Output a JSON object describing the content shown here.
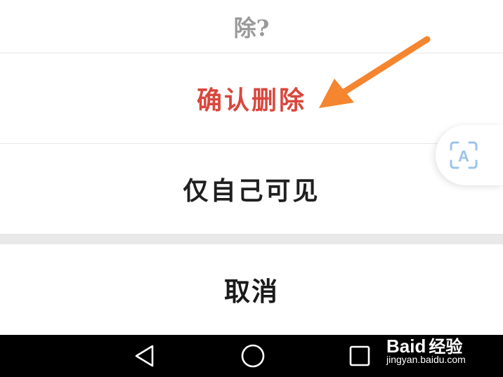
{
  "dialog": {
    "prompt_tail": "除?"
  },
  "action_sheet": {
    "confirm_delete": "确认删除",
    "visible_to_self": "仅自己可见",
    "cancel": "取消"
  },
  "floating_button": {
    "icon": "text-recognition-icon",
    "glyph": "A"
  },
  "nav_bar": {
    "back_icon": "back-triangle-icon",
    "home_icon": "home-circle-icon",
    "recent_icon": "recent-apps-square-icon"
  },
  "watermark": {
    "brand": "Bai",
    "brand_suffix": "经验",
    "url": "jingyan.baidu.com"
  },
  "colors": {
    "destructive": "#d9473d",
    "arrow": "#f5852e",
    "separator": "#e6e6e6",
    "nav_background": "#000000"
  }
}
